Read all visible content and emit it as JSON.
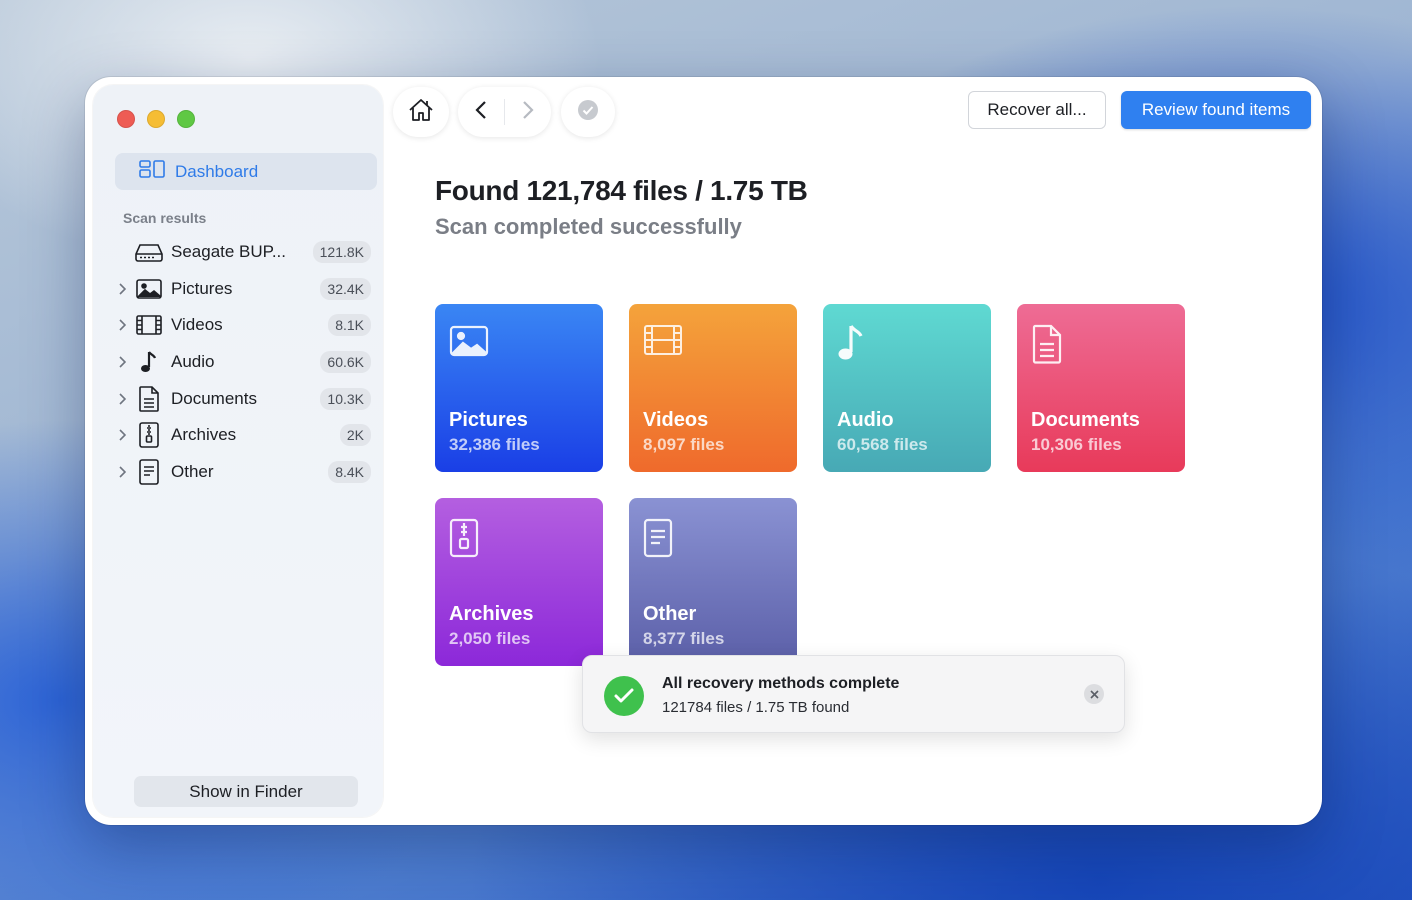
{
  "sidebar": {
    "dashboard_label": "Dashboard",
    "section_title": "Scan results",
    "items": [
      {
        "label": "Seagate BUP...",
        "count": "121.8K",
        "icon": "hard-drive-icon",
        "expandable": false
      },
      {
        "label": "Pictures",
        "count": "32.4K",
        "icon": "picture-icon",
        "expandable": true
      },
      {
        "label": "Videos",
        "count": "8.1K",
        "icon": "film-icon",
        "expandable": true
      },
      {
        "label": "Audio",
        "count": "60.6K",
        "icon": "music-note-icon",
        "expandable": true
      },
      {
        "label": "Documents",
        "count": "10.3K",
        "icon": "document-icon",
        "expandable": true
      },
      {
        "label": "Archives",
        "count": "2K",
        "icon": "archive-icon",
        "expandable": true
      },
      {
        "label": "Other",
        "count": "8.4K",
        "icon": "other-file-icon",
        "expandable": true
      }
    ],
    "finder_button": "Show in Finder"
  },
  "toolbar": {
    "recover_all": "Recover all...",
    "review": "Review found items"
  },
  "main": {
    "title": "Found 121,784 files / 1.75 TB",
    "subtitle": "Scan completed successfully",
    "cards": [
      {
        "name": "Pictures",
        "count": "32,386 files",
        "icon": "picture-icon"
      },
      {
        "name": "Videos",
        "count": "8,097 files",
        "icon": "film-icon"
      },
      {
        "name": "Audio",
        "count": "60,568 files",
        "icon": "music-note-icon"
      },
      {
        "name": "Documents",
        "count": "10,306 files",
        "icon": "document-icon"
      },
      {
        "name": "Archives",
        "count": "2,050 files",
        "icon": "archive-icon"
      },
      {
        "name": "Other",
        "count": "8,377 files",
        "icon": "other-file-icon"
      }
    ]
  },
  "toast": {
    "title": "All recovery methods complete",
    "subtitle": "121784 files / 1.75 TB found"
  },
  "colors": {
    "accent": "#2f80f0",
    "pictures": "#1a3fe6",
    "videos": "#ef6a2c",
    "audio": "#47a9b5",
    "documents": "#e83a5a",
    "archives": "#8c28d9",
    "other": "#5b5fa8",
    "success": "#3fc14d"
  }
}
